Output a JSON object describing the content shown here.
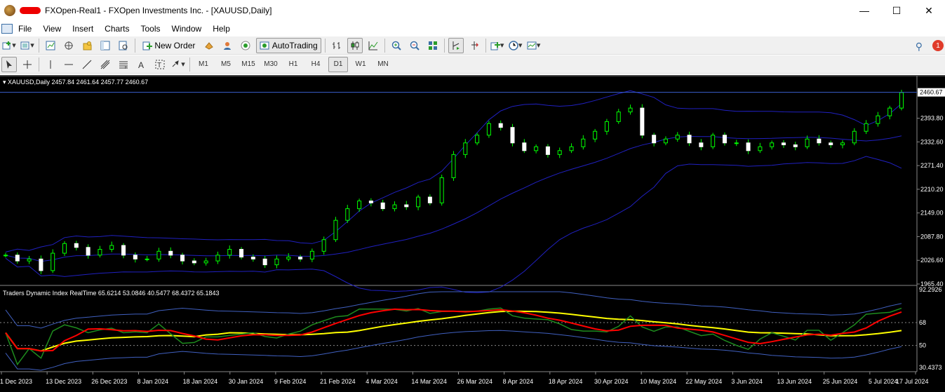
{
  "window": {
    "title": "FXOpen-Real1 - FXOpen Investments Inc. - [XAUUSD,Daily]",
    "minimize": "—",
    "maximize": "☐",
    "close": "✕"
  },
  "menu": [
    "File",
    "View",
    "Insert",
    "Charts",
    "Tools",
    "Window",
    "Help"
  ],
  "toolbar": {
    "new_order": "New Order",
    "auto_trading": "AutoTrading"
  },
  "timeframes": [
    "M1",
    "M5",
    "M15",
    "M30",
    "H1",
    "H4",
    "D1",
    "W1",
    "MN"
  ],
  "active_timeframe": "D1",
  "notifications": "1",
  "chart": {
    "header": "XAUUSD,Daily  2457.84 2461.64 2457.77 2460.67",
    "current_price": "2460.67",
    "price_ticks": [
      "2393.80",
      "2332.60",
      "2271.40",
      "2210.20",
      "2149.00",
      "2087.80",
      "2026.60",
      "1965.40"
    ],
    "indicator_header": "Traders Dynamic Index RealTime 65.6214 53.0846 40.5477 68.4372 65.1843",
    "indicator_ticks": [
      "92.2926",
      "68",
      "50",
      "30.4373"
    ],
    "date_labels": [
      "1 Dec 2023",
      "13 Dec 2023",
      "26 Dec 2023",
      "8 Jan 2024",
      "18 Jan 2024",
      "30 Jan 2024",
      "9 Feb 2024",
      "21 Feb 2024",
      "4 Mar 2024",
      "14 Mar 2024",
      "26 Mar 2024",
      "8 Apr 2024",
      "18 Apr 2024",
      "30 Apr 2024",
      "10 May 2024",
      "22 May 2024",
      "3 Jun 2024",
      "13 Jun 2024",
      "25 Jun 2024",
      "5 Jul 2024",
      "17 Jul 2024"
    ],
    "colors": {
      "background": "#000000",
      "bull_candle": "#00ff00",
      "bollinger": "#2020c0",
      "rsi_green": "#1e8c1e",
      "signal_red": "#ff0000",
      "market_base_yellow": "#ffff00",
      "volatility_band": "#4060c0"
    }
  },
  "chart_data": {
    "type": "candlestick",
    "title": "XAUUSD,Daily",
    "ylim": [
      1965.4,
      2480
    ],
    "close_approx": [
      2040,
      2025,
      2030,
      2000,
      2045,
      2070,
      2060,
      2040,
      2055,
      2065,
      2040,
      2030,
      2030,
      2050,
      2040,
      2025,
      2020,
      2025,
      2040,
      2055,
      2035,
      2030,
      2015,
      2030,
      2035,
      2030,
      2050,
      2080,
      2130,
      2160,
      2180,
      2175,
      2160,
      2170,
      2165,
      2190,
      2175,
      2240,
      2300,
      2330,
      2350,
      2380,
      2370,
      2330,
      2310,
      2320,
      2300,
      2310,
      2320,
      2340,
      2360,
      2385,
      2410,
      2420,
      2350,
      2330,
      2340,
      2350,
      2330,
      2320,
      2350,
      2330,
      2330,
      2310,
      2320,
      2330,
      2325,
      2320,
      2340,
      2330,
      2325,
      2330,
      2360,
      2380,
      2400,
      2420,
      2460
    ]
  }
}
